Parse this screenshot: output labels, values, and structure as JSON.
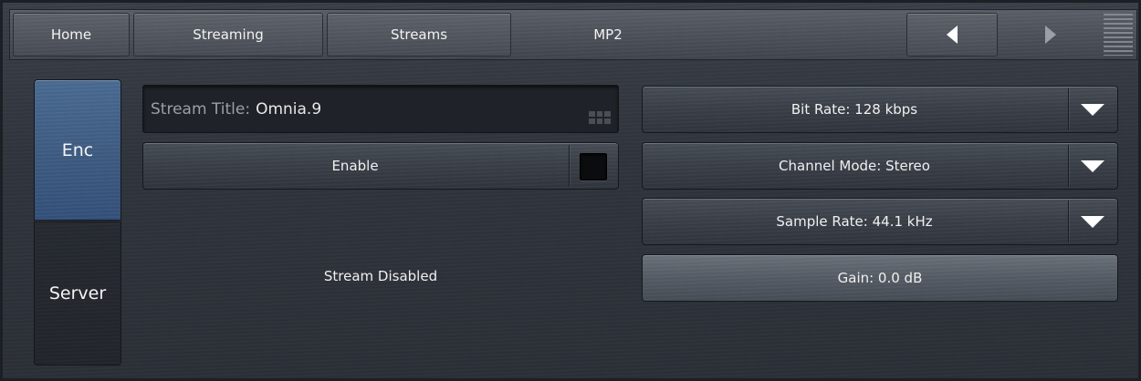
{
  "nav": {
    "home": "Home",
    "streaming": "Streaming",
    "streams": "Streams",
    "current": "MP2",
    "prev_icon": "arrow-left-icon",
    "next_icon": "arrow-right-icon",
    "menu_icon": "menu-icon"
  },
  "sidebar": {
    "tabs": [
      {
        "label": "Enc",
        "active": true
      },
      {
        "label": "Server",
        "active": false
      }
    ]
  },
  "encoder": {
    "stream_title": {
      "prefix": "Stream Title:",
      "value": "Omnia.9"
    },
    "enable_label": "Enable",
    "enable_checked": false,
    "status": "Stream Disabled",
    "bit_rate": "Bit Rate: 128 kbps",
    "channel_mode": "Channel Mode: Stereo",
    "sample_rate": "Sample Rate: 44.1 kHz",
    "gain": "Gain: 0.0 dB"
  },
  "colors": {
    "active_tab": "#3d5a80",
    "background": "#2b2f37"
  }
}
